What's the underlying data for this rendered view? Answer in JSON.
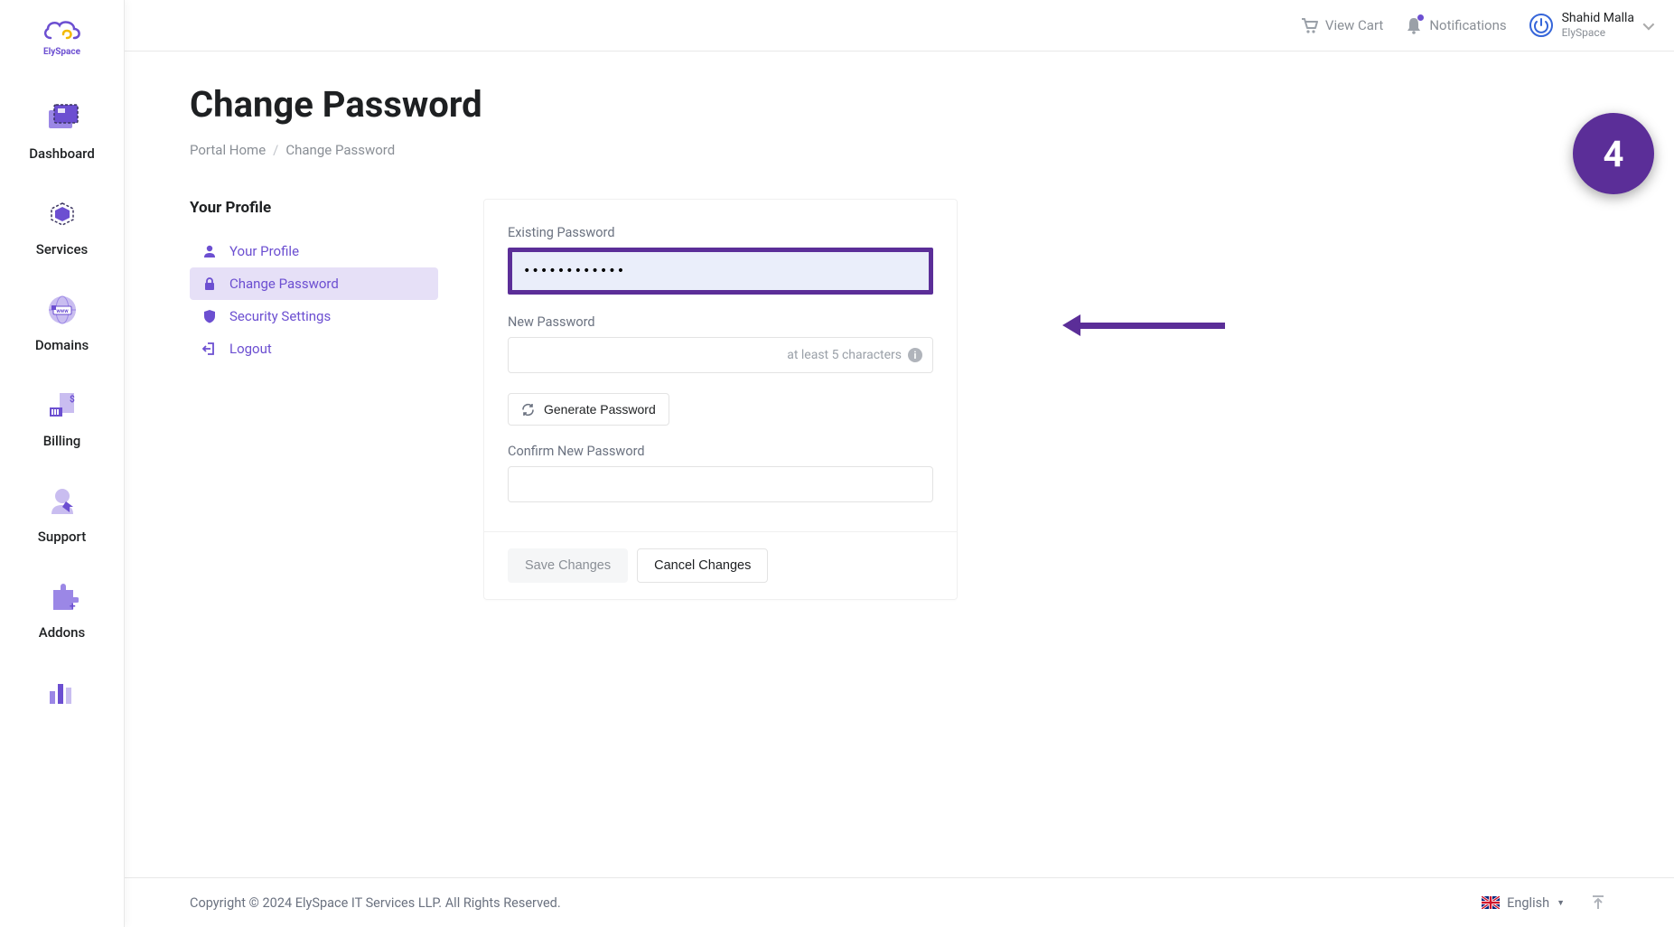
{
  "brand": {
    "name": "ElySpace"
  },
  "sidebar": {
    "items": [
      {
        "label": "Dashboard"
      },
      {
        "label": "Services"
      },
      {
        "label": "Domains"
      },
      {
        "label": "Billing"
      },
      {
        "label": "Support"
      },
      {
        "label": "Addons"
      }
    ]
  },
  "topbar": {
    "view_cart": "View Cart",
    "notifications": "Notifications",
    "account": {
      "name": "Shahid Malla",
      "company": "ElySpace"
    }
  },
  "page": {
    "title": "Change Password",
    "breadcrumb": {
      "home": "Portal Home",
      "current": "Change Password"
    }
  },
  "profile_nav": {
    "header": "Your Profile",
    "items": [
      {
        "label": "Your Profile"
      },
      {
        "label": "Change Password"
      },
      {
        "label": "Security Settings"
      },
      {
        "label": "Logout"
      }
    ]
  },
  "form": {
    "existing_label": "Existing Password",
    "existing_value": "••••••••••••",
    "new_label": "New Password",
    "new_hint": "at least 5 characters",
    "generate": "Generate Password",
    "confirm_label": "Confirm New Password",
    "save": "Save Changes",
    "cancel": "Cancel Changes"
  },
  "annotation": {
    "step": "4"
  },
  "footer": {
    "copyright": "Copyright © 2024 ElySpace IT Services LLP. All Rights Reserved.",
    "language": "English"
  },
  "colors": {
    "accent": "#5b2e98",
    "purple_light": "#9b87e6"
  }
}
